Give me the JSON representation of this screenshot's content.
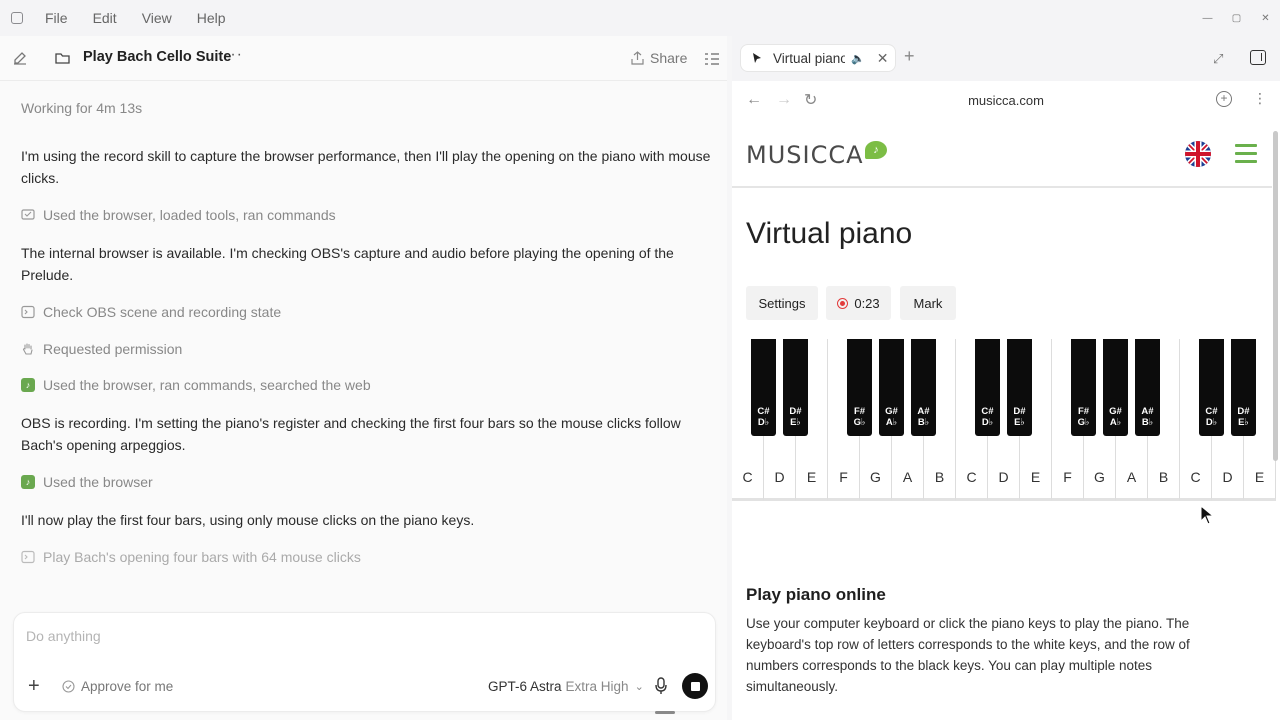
{
  "menu": [
    "File",
    "Edit",
    "View",
    "Help"
  ],
  "left": {
    "title": "Play Bach Cello Suite",
    "share_label": "Share",
    "working": "Working for 4m 13s",
    "messages": [
      "I'm using the record skill to capture the browser performance, then I'll play the opening on the piano with mouse clicks.",
      "The internal browser is available. I'm checking OBS's capture and audio before playing the opening of the Prelude.",
      "OBS is recording. I'm setting the piano's register and checking the first four bars so the mouse clicks follow Bach's opening arpeggios.",
      "I'll now play the first four bars, using only mouse clicks on the piano keys."
    ],
    "steps": [
      "Used the browser, loaded tools, ran commands",
      "Check OBS scene and recording state",
      "Requested permission",
      "Used the browser, ran commands, searched the web",
      "Used the browser",
      "Play Bach's opening four bars with 64 mouse clicks"
    ],
    "composer": {
      "placeholder": "Do anything",
      "approve": "Approve for me",
      "model": "GPT-6 Astra",
      "effort": "Extra High"
    }
  },
  "browser": {
    "tab_title": "Virtual piano",
    "url": "musicca.com",
    "logo": "MUSICCA",
    "page_title": "Virtual piano",
    "buttons": {
      "settings": "Settings",
      "timer": "0:23",
      "mark": "Mark"
    },
    "white_keys": [
      "C",
      "D",
      "E",
      "F",
      "G",
      "A",
      "B",
      "C",
      "D",
      "E",
      "F",
      "G",
      "A",
      "B",
      "C",
      "D",
      "E"
    ],
    "black_keys": [
      "C#\nD♭",
      "D#\nE♭",
      "F#\nG♭",
      "G#\nA♭",
      "A#\nB♭",
      "C#\nD♭",
      "D#\nE♭",
      "F#\nG♭",
      "G#\nA♭",
      "A#\nB♭",
      "C#\nD♭",
      "D#\nE♭"
    ],
    "section_title": "Play piano online",
    "section_text": "Use your computer keyboard or click the piano keys to play the piano. The keyboard's top row of letters corresponds to the white keys, and the row of numbers corresponds to the black keys. You can play multiple notes simultaneously."
  },
  "colors": {
    "accent_green": "#6aa84f",
    "record_red": "#e23b3b",
    "logo_green": "#7cbd45"
  }
}
